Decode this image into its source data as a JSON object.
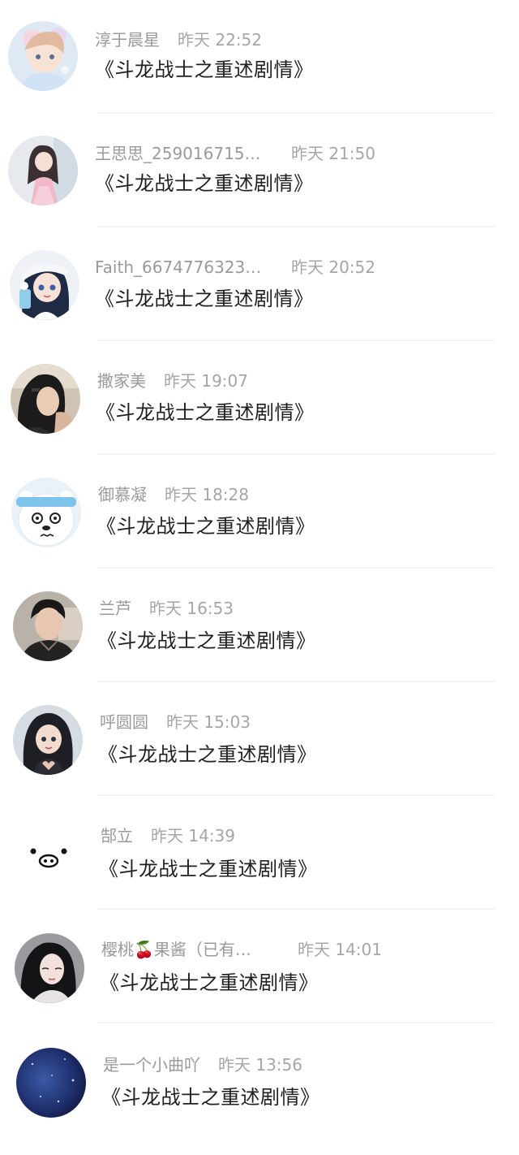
{
  "comments": [
    {
      "name": "淳于晨星",
      "time": "昨天 22:52",
      "text": "《斗龙战士之重述剧情》",
      "avatar_icon": "anime-boy-avatar-icon"
    },
    {
      "name": "王思思_259016715…",
      "time": "昨天 21:50",
      "text": "《斗龙战士之重述剧情》",
      "avatar_icon": "anime-girl-pink-dress-avatar-icon"
    },
    {
      "name": "Faith_6674776323…",
      "time": "昨天 20:52",
      "text": "《斗龙战士之重述剧情》",
      "avatar_icon": "anime-girl-hat-drink-avatar-icon"
    },
    {
      "name": "撒家美",
      "time": "昨天 19:07",
      "text": "《斗龙战士之重述剧情》",
      "avatar_icon": "girl-photo-avatar-icon"
    },
    {
      "name": "御慕凝",
      "time": "昨天 18:28",
      "text": "《斗龙战士之重述剧情》",
      "avatar_icon": "polar-bear-avatar-icon"
    },
    {
      "name": "兰芦",
      "time": "昨天 16:53",
      "text": "《斗龙战士之重述剧情》",
      "avatar_icon": "man-photo-avatar-icon"
    },
    {
      "name": "呼圆圆",
      "time": "昨天 15:03",
      "text": "《斗龙战士之重述剧情》",
      "avatar_icon": "3d-girl-heart-avatar-icon"
    },
    {
      "name": "郜立",
      "time": "昨天 14:39",
      "text": "《斗龙战士之重述剧情》",
      "avatar_icon": "pig-face-avatar-icon"
    },
    {
      "name": "樱桃🍒果酱（已有…",
      "time": "昨天 14:01",
      "text": "《斗龙战士之重述剧情》",
      "avatar_icon": "woman-photo-avatar-icon"
    },
    {
      "name": "是一个小曲吖",
      "time": "昨天 13:56",
      "text": "《斗龙战士之重述剧情》",
      "avatar_icon": "blue-night-sky-avatar-icon"
    }
  ]
}
